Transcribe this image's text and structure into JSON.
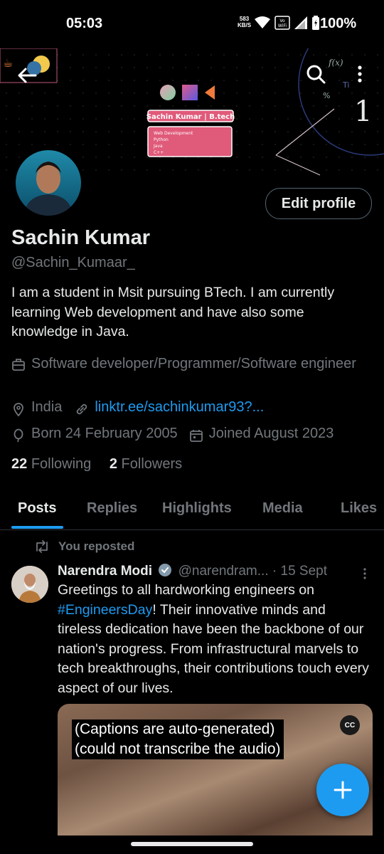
{
  "status_bar": {
    "time": "05:03",
    "net_speed_value": "583",
    "net_speed_unit": "KB/S",
    "vowifi": "Vo\nWiFi",
    "battery": "100%"
  },
  "banner": {
    "card_title": "Sachin Kumar | B.tech",
    "skills": [
      "Web Development",
      "Python",
      "Java",
      "C++"
    ],
    "math_labels": [
      "f(x)",
      "Ti",
      "1",
      "%"
    ]
  },
  "profile": {
    "edit_label": "Edit profile",
    "name": "Sachin Kumar",
    "handle": "@Sachin_Kumaar_",
    "bio": "I am a student in Msit pursuing BTech. I am currently learning Web development and have also some knowledge in Java.",
    "profession": "Software developer/Programmer/Software engineer",
    "location": "India",
    "link": "linktr.ee/sachinkumar93?...",
    "born": "Born 24 February 2005",
    "joined": "Joined August 2023",
    "following_count": "22",
    "following_label": "Following",
    "followers_count": "2",
    "followers_label": "Followers"
  },
  "tabs": [
    "Posts",
    "Replies",
    "Highlights",
    "Media",
    "Likes"
  ],
  "active_tab": "Posts",
  "post": {
    "repost_label": "You reposted",
    "author": "Narendra Modi",
    "handle": "@narendram...",
    "time": "· 15 Sept",
    "text_before": "Greetings to all hardworking engineers on ",
    "hashtag": "#EngineersDay",
    "text_after": "! Their innovative minds and tireless dedication have been the backbone of our nation's progress. From infrastructural marvels to tech breakthroughs, their contributions touch every aspect of our lives.",
    "caption_line1": "(Captions are auto-generated)",
    "caption_line2": "(could not transcribe the audio)",
    "cc_label": "CC"
  },
  "colors": {
    "accent": "#1d9bf0",
    "muted": "#71767b",
    "text": "#e7e9ea",
    "background": "#000000"
  },
  "icons": [
    "back-arrow-icon",
    "search-icon",
    "more-vertical-icon",
    "briefcase-icon",
    "location-pin-icon",
    "link-icon",
    "balloon-icon",
    "calendar-icon",
    "repost-icon",
    "verified-badge-icon",
    "compose-plus-icon"
  ]
}
